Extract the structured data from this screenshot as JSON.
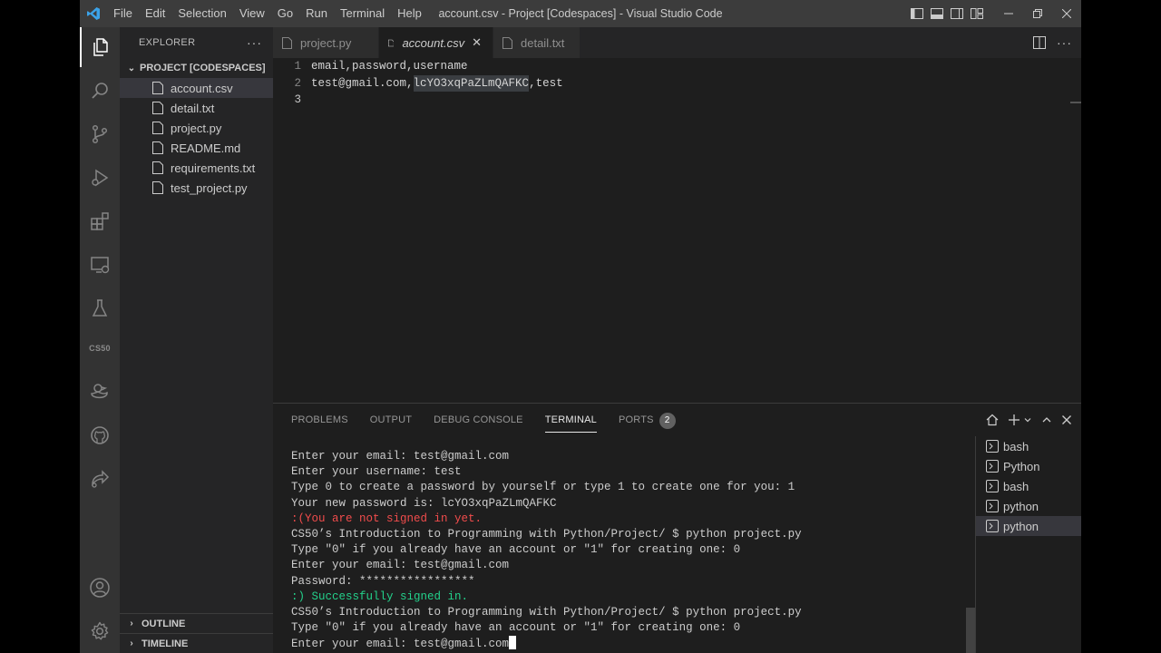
{
  "titlebar": {
    "menu": [
      "File",
      "Edit",
      "Selection",
      "View",
      "Go",
      "Run",
      "Terminal",
      "Help"
    ],
    "window_title": "account.csv - Project [Codespaces] - Visual Studio Code"
  },
  "activity_bar": {
    "items": [
      "explorer-icon",
      "search-icon",
      "source-control-icon",
      "run-debug-icon",
      "extensions-icon",
      "remote-explorer-icon",
      "testing-icon",
      "cs50",
      "duck-icon",
      "github-icon",
      "live-share-icon"
    ],
    "cs50_label": "CS50",
    "bottom": [
      "account-icon",
      "settings-gear-icon"
    ]
  },
  "sidebar": {
    "header": "EXPLORER",
    "more": "···",
    "folder": "PROJECT [CODESPACES]",
    "files": [
      "account.csv",
      "detail.txt",
      "project.py",
      "README.md",
      "requirements.txt",
      "test_project.py"
    ],
    "selected_file": "account.csv",
    "outline": "OUTLINE",
    "timeline": "TIMELINE"
  },
  "editor": {
    "tabs": [
      {
        "label": "project.py"
      },
      {
        "label": "account.csv",
        "close": "✕"
      },
      {
        "label": "detail.txt"
      }
    ],
    "lines": [
      {
        "n": "1",
        "text": "email,password,username"
      },
      {
        "n": "2",
        "pre": "test@gmail.com,",
        "hl": "lcYO3xqPaZLmQAFKC",
        "post": ",test"
      },
      {
        "n": "3",
        "text": ""
      }
    ]
  },
  "panel": {
    "tabs": [
      "PROBLEMS",
      "OUTPUT",
      "DEBUG CONSOLE",
      "TERMINAL",
      "PORTS"
    ],
    "active_tab": "TERMINAL",
    "ports_badge": "2",
    "terminal_lines": [
      {
        "text": "Enter your email: test@gmail.com",
        "color": "#cccccc"
      },
      {
        "text": "Enter your username: test",
        "color": "#cccccc"
      },
      {
        "text": "Type 0 to create a password by yourself or type 1 to create one for you: 1",
        "color": "#cccccc"
      },
      {
        "text": "Your new password is: lcYO3xqPaZLmQAFKC",
        "color": "#cccccc"
      },
      {
        "text": ":(You are not signed in yet.",
        "color": "#f14c4c"
      },
      {
        "text": "CS50’s Introduction to Programming with Python/Project/ $ python project.py",
        "color": "#cccccc"
      },
      {
        "text": "Type \"0\" if you already have an account or \"1\" for creating one: 0",
        "color": "#cccccc"
      },
      {
        "text": "Enter your email: test@gmail.com",
        "color": "#cccccc"
      },
      {
        "text": "Password: *****************",
        "color": "#cccccc"
      },
      {
        "text": ":) Successfully signed in.",
        "color": "#23d18b"
      },
      {
        "text": "CS50’s Introduction to Programming with Python/Project/ $ python project.py",
        "color": "#cccccc"
      },
      {
        "text": "Type \"0\" if you already have an account or \"1\" for creating one: 0",
        "color": "#cccccc"
      },
      {
        "text": "Enter your email: test@gmail.com",
        "color": "#cccccc"
      }
    ],
    "terminals": [
      "bash",
      "Python",
      "bash",
      "python",
      "python"
    ],
    "active_terminal": "python"
  }
}
